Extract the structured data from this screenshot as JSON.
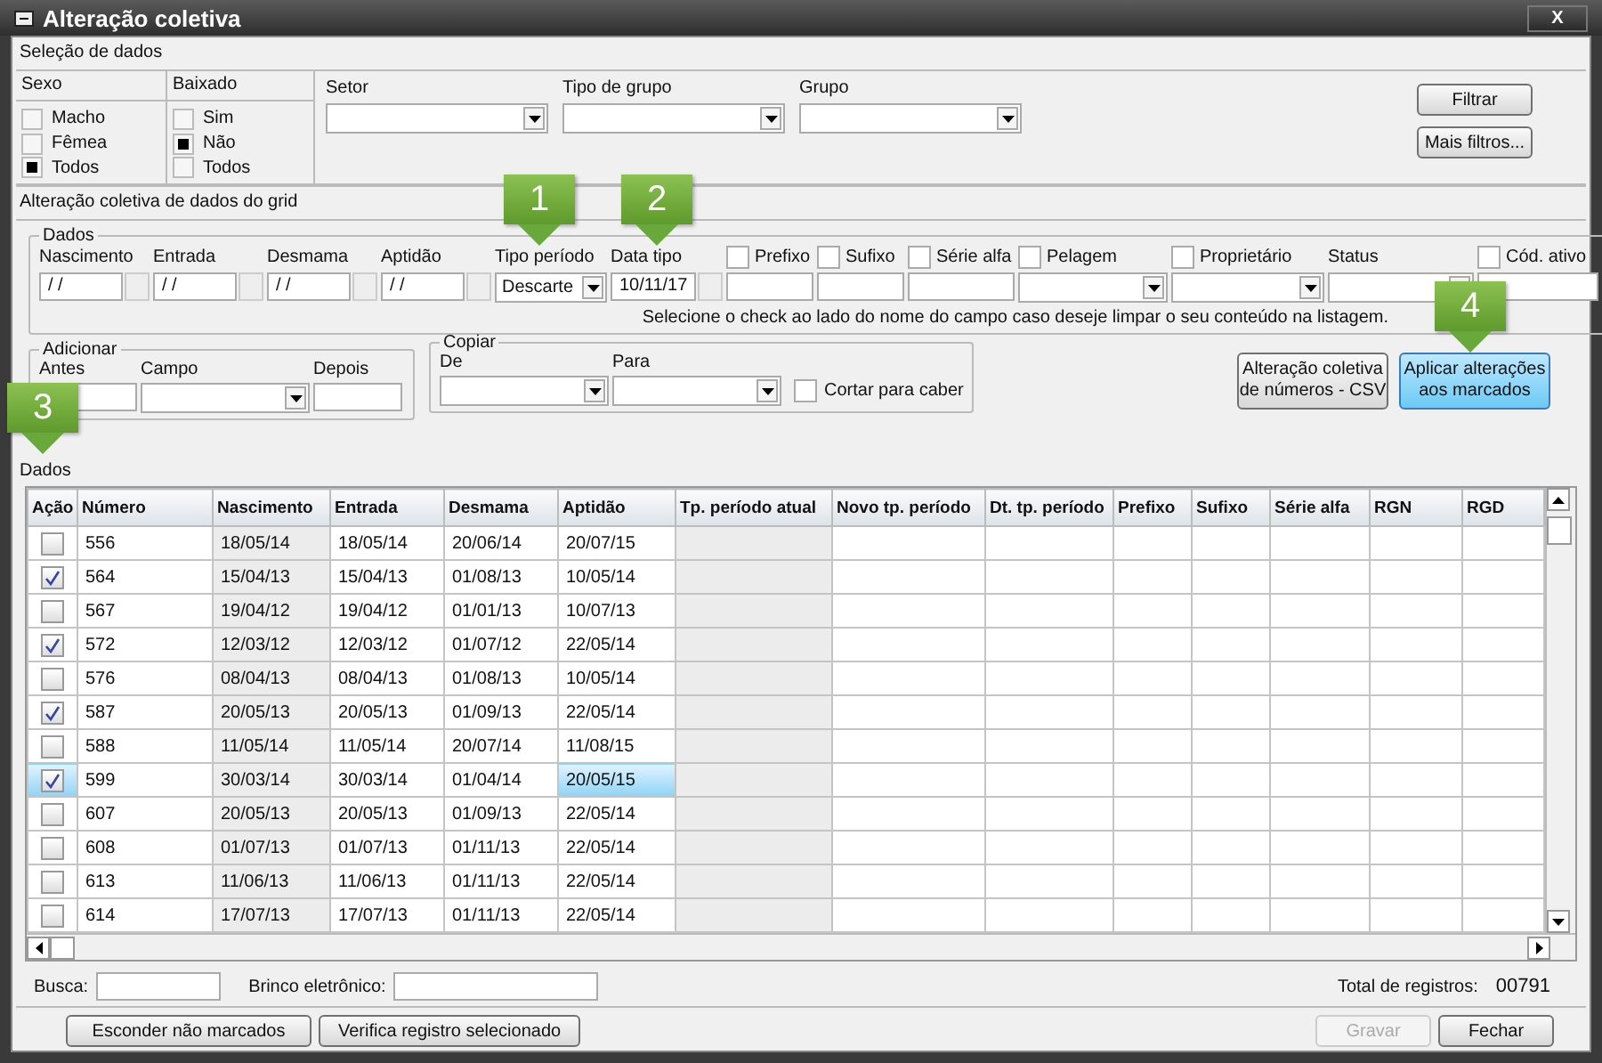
{
  "window": {
    "title": "Alteração coletiva",
    "close": "X"
  },
  "selection": {
    "title": "Seleção de dados",
    "groups": [
      {
        "label": "Sexo",
        "options": [
          {
            "label": "Macho",
            "selected": false
          },
          {
            "label": "Fêmea",
            "selected": false
          },
          {
            "label": "Todos",
            "selected": true
          }
        ]
      },
      {
        "label": "Baixado",
        "options": [
          {
            "label": "Sim",
            "selected": false
          },
          {
            "label": "Não",
            "selected": true
          },
          {
            "label": "Todos",
            "selected": false
          }
        ]
      }
    ],
    "dropdowns": [
      {
        "label": "Setor"
      },
      {
        "label": "Tipo de grupo"
      },
      {
        "label": "Grupo"
      }
    ],
    "buttons": [
      "Filtrar",
      "Mais filtros..."
    ]
  },
  "bulk_edit": {
    "title": "Alteração coletiva de dados do grid",
    "dados": {
      "legend": "Dados",
      "fields": [
        {
          "label": "Nascimento",
          "kind": "date",
          "value": "/ /"
        },
        {
          "label": "Entrada",
          "kind": "date",
          "value": "/ /"
        },
        {
          "label": "Desmama",
          "kind": "date",
          "value": "/ /"
        },
        {
          "label": "Aptidão",
          "kind": "date",
          "value": "/ /"
        },
        {
          "label": "Tipo período",
          "kind": "select",
          "value": "Descarte"
        },
        {
          "label": "Data tipo",
          "kind": "date",
          "value": "10/11/17"
        },
        {
          "label": "Prefixo",
          "kind": "text",
          "clear_check": false
        },
        {
          "label": "Sufixo",
          "kind": "text",
          "clear_check": false
        },
        {
          "label": "Série alfa",
          "kind": "text",
          "clear_check": false
        },
        {
          "label": "Pelagem",
          "kind": "select",
          "clear_check": false
        },
        {
          "label": "Proprietário",
          "kind": "select",
          "clear_check": false
        },
        {
          "label": "Status",
          "kind": "select"
        },
        {
          "label": "Cód. ativo",
          "kind": "text",
          "clear_check": false
        }
      ],
      "note": "Selecione o check ao lado do nome do campo caso deseje limpar o seu conteúdo na listagem."
    },
    "adicionar": {
      "legend": "Adicionar",
      "labels": [
        "Antes",
        "Campo",
        "Depois"
      ]
    },
    "copiar": {
      "legend": "Copiar",
      "labels": [
        "De",
        "Para"
      ],
      "checkbox": {
        "label": "Cortar para caber",
        "checked": false
      }
    },
    "buttons": [
      {
        "label": "Alteração coletiva de números - CSV",
        "primary": false
      },
      {
        "label": "Aplicar alterações aos marcados",
        "primary": true
      }
    ]
  },
  "grid": {
    "title": "Dados",
    "action_column": "Ação",
    "columns": [
      "Número",
      "Nascimento",
      "Entrada",
      "Desmama",
      "Aptidão",
      "Tp. período atual",
      "Novo tp. período",
      "Dt. tp. período",
      "Prefixo",
      "Sufixo",
      "Série alfa",
      "RGN",
      "RGD"
    ],
    "rows": [
      {
        "checked": false,
        "selected": false,
        "cells": [
          "556",
          "18/05/14",
          "18/05/14",
          "20/06/14",
          "20/07/15"
        ]
      },
      {
        "checked": true,
        "selected": false,
        "cells": [
          "564",
          "15/04/13",
          "15/04/13",
          "01/08/13",
          "10/05/14"
        ]
      },
      {
        "checked": false,
        "selected": false,
        "cells": [
          "567",
          "19/04/12",
          "19/04/12",
          "01/01/13",
          "10/07/13"
        ]
      },
      {
        "checked": true,
        "selected": false,
        "cells": [
          "572",
          "12/03/12",
          "12/03/12",
          "01/07/12",
          "22/05/14"
        ]
      },
      {
        "checked": false,
        "selected": false,
        "cells": [
          "576",
          "08/04/13",
          "08/04/13",
          "01/08/13",
          "10/05/14"
        ]
      },
      {
        "checked": true,
        "selected": false,
        "cells": [
          "587",
          "20/05/13",
          "20/05/13",
          "01/09/13",
          "22/05/14"
        ]
      },
      {
        "checked": false,
        "selected": false,
        "cells": [
          "588",
          "11/05/14",
          "11/05/14",
          "20/07/14",
          "11/08/15"
        ]
      },
      {
        "checked": true,
        "selected": true,
        "cells": [
          "599",
          "30/03/14",
          "30/03/14",
          "01/04/14",
          "20/05/15"
        ]
      },
      {
        "checked": false,
        "selected": false,
        "cells": [
          "607",
          "20/05/13",
          "20/05/13",
          "01/09/13",
          "22/05/14"
        ]
      },
      {
        "checked": false,
        "selected": false,
        "cells": [
          "608",
          "01/07/13",
          "01/07/13",
          "01/11/13",
          "22/05/14"
        ]
      },
      {
        "checked": false,
        "selected": false,
        "cells": [
          "613",
          "11/06/13",
          "11/06/13",
          "01/11/13",
          "22/05/14"
        ]
      },
      {
        "checked": false,
        "selected": false,
        "cells": [
          "614",
          "17/07/13",
          "17/07/13",
          "01/11/13",
          "22/05/14"
        ]
      }
    ]
  },
  "search": {
    "busca_label": "Busca:",
    "brinco_label": "Brinco eletrônico:",
    "total_label": "Total de registros:",
    "total": "00791"
  },
  "footer": {
    "buttons": [
      {
        "label": "Esconder não marcados",
        "disabled": false
      },
      {
        "label": "Verifica registro selecionado",
        "disabled": false
      }
    ],
    "actions": [
      {
        "label": "Gravar",
        "disabled": true
      },
      {
        "label": "Fechar",
        "disabled": false
      }
    ]
  },
  "callouts": [
    "1",
    "2",
    "3",
    "4"
  ]
}
